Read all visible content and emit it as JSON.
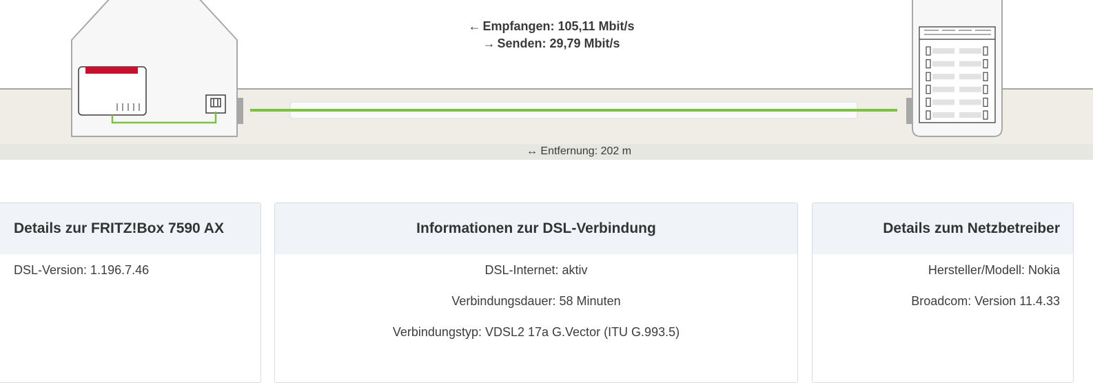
{
  "connection": {
    "receive_label": "Empfangen: 105,11 Mbit/s",
    "send_label": "Senden: 29,79 Mbit/s",
    "distance_label": "Entfernung: 202 m",
    "line_color": "#7dc142",
    "brand_red": "#c8102e"
  },
  "cards": {
    "fritzbox": {
      "title": "Details zur FRITZ!Box 7590 AX",
      "rows": [
        "DSL-Version: 1.196.7.46"
      ]
    },
    "dsl": {
      "title": "Informationen zur DSL-Verbindung",
      "rows": [
        "DSL-Internet: aktiv",
        "Verbindungsdauer: 58 Minuten",
        "Verbindungstyp: VDSL2 17a G.Vector (ITU G.993.5)"
      ]
    },
    "provider": {
      "title": "Details zum Netzbetreiber",
      "rows": [
        "Hersteller/Modell: Nokia",
        "Broadcom: Version 11.4.33"
      ]
    }
  }
}
